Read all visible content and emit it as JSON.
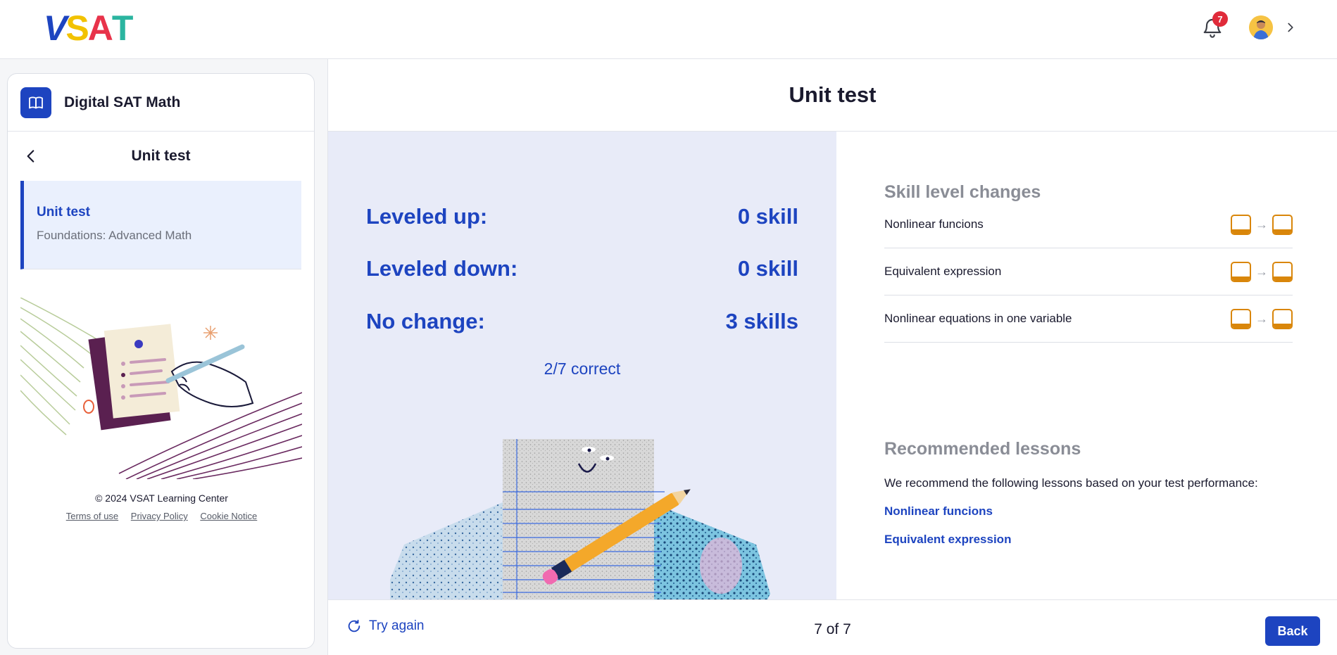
{
  "header": {
    "logo": {
      "v": "V",
      "s": "S",
      "a": "A",
      "t": "T"
    },
    "notification_count": "7",
    "icons": {
      "bell": "bell-icon",
      "profile_menu": "chevron-right-icon"
    }
  },
  "sidebar": {
    "course_title": "Digital SAT Math",
    "course_icon": "book-icon",
    "section_title": "Unit test",
    "active_item": {
      "title": "Unit test",
      "subtitle": "Foundations: Advanced Math"
    },
    "copyright": "© 2024 VSAT Learning Center",
    "links": [
      "Terms of use",
      "Privacy Policy",
      "Cookie Notice"
    ]
  },
  "main": {
    "title": "Unit test",
    "stats": [
      {
        "label": "Leveled up:",
        "value": "0 skill"
      },
      {
        "label": "Leveled down:",
        "value": "0 skill"
      },
      {
        "label": "No change:",
        "value": "3 skills"
      }
    ],
    "correct_summary": "2/7 correct",
    "skill_level_heading": "Skill level changes",
    "skills": [
      "Nonlinear funcions",
      "Equivalent expression",
      "Nonlinear equations in one variable"
    ],
    "recommended_heading": "Recommended lessons",
    "recommended_text": "We recommend the following lessons based on your test performance:",
    "recommended_lessons": [
      "Nonlinear funcions",
      "Equivalent expression"
    ]
  },
  "footer": {
    "try_again": "Try again",
    "page_count": "7 of 7",
    "back_label": "Back"
  },
  "colors": {
    "brand_blue": "#1d44c0",
    "skill_orange": "#d9860a",
    "panel_lavender": "#e8ebf8",
    "badge_red": "#e02b3a"
  }
}
